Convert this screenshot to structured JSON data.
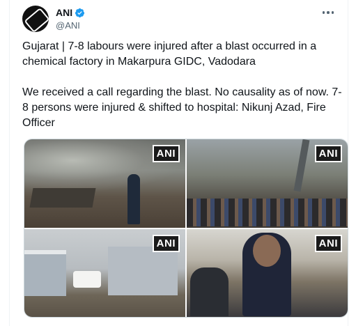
{
  "tweet": {
    "author_name": "ANI",
    "author_handle": "@ANI",
    "avatar_text": "ANI",
    "text": "Gujarat | 7-8 labours were injured after a blast occurred in a chemical factory in Makarpura GIDC, Vadodara\n\nWe received a call regarding the blast. No causality as of now. 7-8 persons were injured & shifted to hospital: Nikunj Azad, Fire Officer"
  },
  "media": [
    {
      "watermark": "ANI"
    },
    {
      "watermark": "ANI"
    },
    {
      "watermark": "ANI"
    },
    {
      "watermark": "ANI"
    }
  ],
  "colors": {
    "verified_badge": "#1d9bf0",
    "handle_text": "#536471",
    "border": "#cfd9de"
  },
  "icons": [
    "verified-badge-icon",
    "more-options-icon"
  ]
}
